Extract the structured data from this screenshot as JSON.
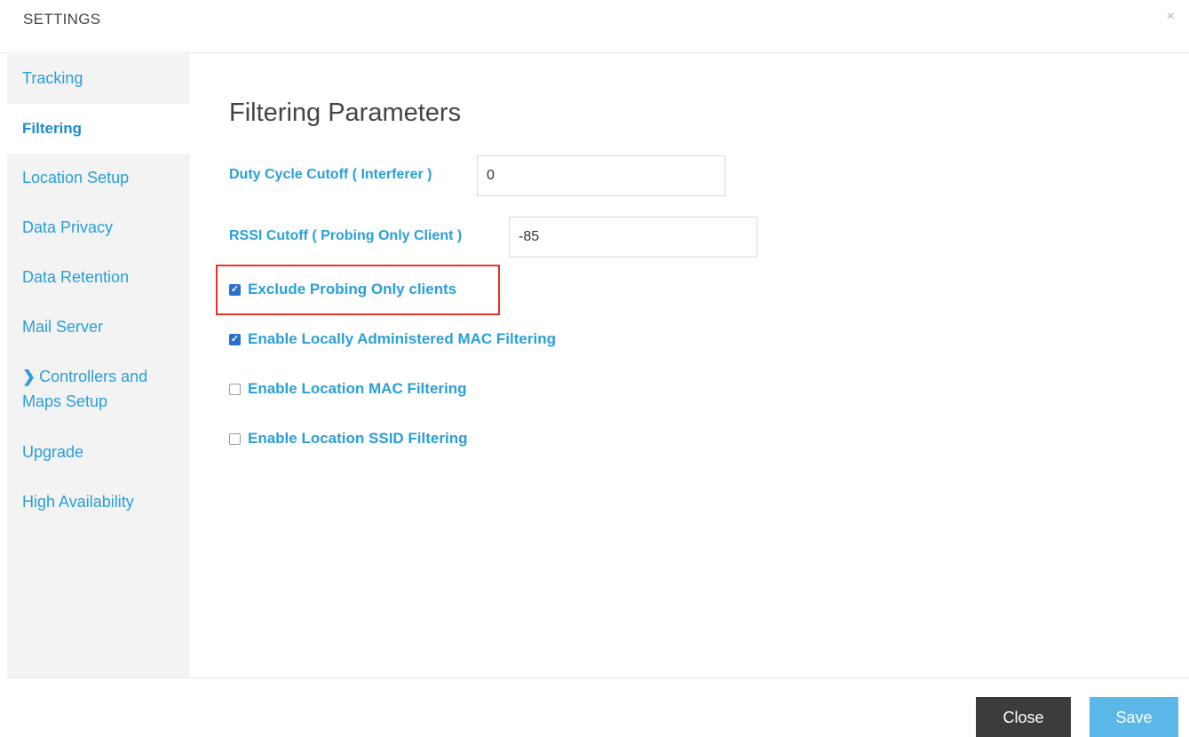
{
  "header": {
    "title": "SETTINGS",
    "close_glyph": "×"
  },
  "sidebar": {
    "items": [
      {
        "label": "Tracking",
        "active": false
      },
      {
        "label": "Filtering",
        "active": true
      },
      {
        "label": "Location Setup",
        "active": false
      },
      {
        "label": "Data Privacy",
        "active": false
      },
      {
        "label": "Data Retention",
        "active": false
      },
      {
        "label": "Mail Server",
        "active": false
      },
      {
        "label_line1": "Controllers and",
        "label_line2": "Maps Setup",
        "icon": "chevron-right-icon",
        "active": false
      },
      {
        "label": "Upgrade",
        "active": false
      },
      {
        "label": "High Availability",
        "active": false
      }
    ]
  },
  "main": {
    "title": "Filtering Parameters",
    "fields": [
      {
        "label": "Duty Cycle Cutoff ( Interferer )",
        "value": "0"
      },
      {
        "label": "RSSI Cutoff ( Probing Only Client )",
        "value": "-85"
      }
    ],
    "checkboxes": [
      {
        "label": "Exclude Probing Only clients",
        "checked": true,
        "highlighted": true
      },
      {
        "label": "Enable Locally Administered MAC Filtering",
        "checked": true
      },
      {
        "label": "Enable Location MAC Filtering",
        "checked": false
      },
      {
        "label": "Enable Location SSID Filtering",
        "checked": false
      }
    ]
  },
  "footer": {
    "close_label": "Close",
    "save_label": "Save"
  },
  "colors": {
    "link_blue": "#2a9fd8",
    "checkbox_blue": "#2a6fd0",
    "highlight_red": "#e8332a",
    "close_button": "#3c3c3c",
    "save_button": "#5bb8e8"
  }
}
